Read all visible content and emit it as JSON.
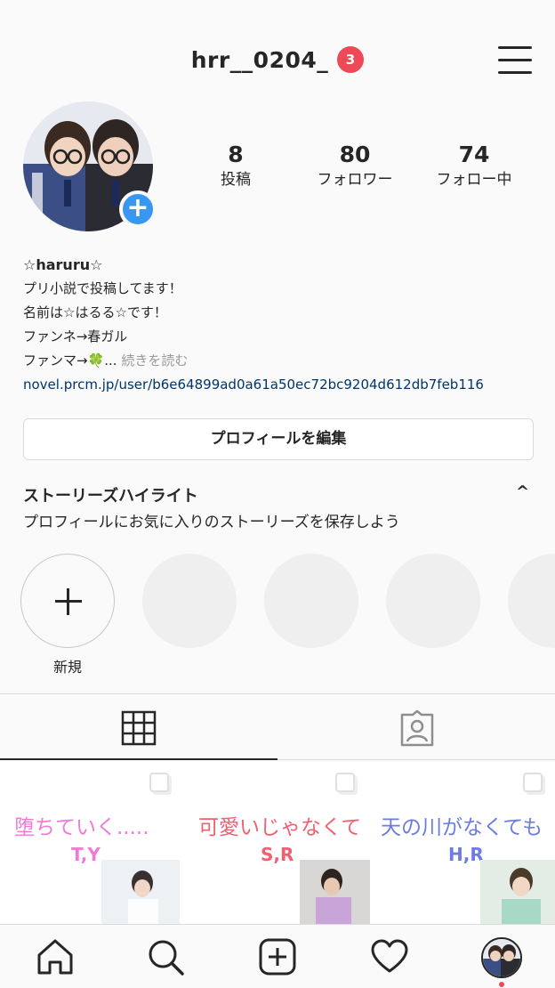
{
  "header": {
    "username": "hrr__0204_",
    "notification_count": "3"
  },
  "stats": [
    {
      "value": "8",
      "label": "投稿"
    },
    {
      "value": "80",
      "label": "フォロワー"
    },
    {
      "value": "74",
      "label": "フォロー中"
    }
  ],
  "bio": {
    "name": "☆haruru☆",
    "lines": [
      "プリ小説で投稿してます！",
      "名前は☆はるる☆です！",
      "ファンネ→春ガル"
    ],
    "last_line": "ファンマ→🍀...",
    "more": "続きを読む",
    "link": "novel.prcm.jp/user/b6e64899ad0a61a50ec72bc9204d612db7feb116"
  },
  "edit_profile_label": "プロフィールを編集",
  "highlights": {
    "title": "ストーリーズハイライト",
    "subtitle": "プロフィールにお気に入りのストーリーズを保存しよう",
    "chevron": "^",
    "new_label": "新規"
  },
  "posts": [
    {
      "title": "堕ちていく.....",
      "initials": "T,Y",
      "title_color": "#f07ad6",
      "initials_color": "#f07ad6"
    },
    {
      "title": "可愛いじゃなくて",
      "initials": "S,R",
      "title_color": "#f06070",
      "initials_color": "#f06070"
    },
    {
      "title": "天の川がなくても",
      "initials": "H,R",
      "title_color": "#6c7ce0",
      "initials_color": "#6c7ce0"
    }
  ],
  "icons": {
    "menu": "hamburger-icon",
    "grid": "grid-icon",
    "tagged": "tagged-person-icon",
    "home": "home-icon",
    "search": "search-icon",
    "add": "add-post-icon",
    "activity": "heart-icon",
    "profile": "profile-avatar-icon"
  },
  "colors": {
    "accent_blue": "#3897f0",
    "badge_red": "#ed4956",
    "link": "#003569"
  }
}
